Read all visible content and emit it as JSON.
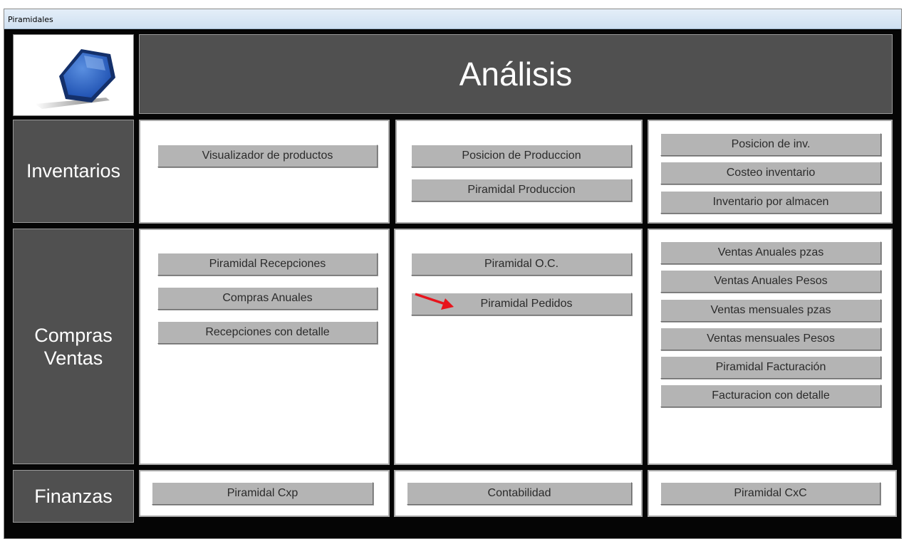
{
  "window": {
    "title": "Piramidales"
  },
  "header": {
    "title": "Análisis"
  },
  "sections": {
    "inventarios": {
      "label": "Inventarios",
      "col1": [
        "Visualizador de productos"
      ],
      "col2": [
        "Posicion de Produccion",
        "Piramidal Produccion"
      ],
      "col3": [
        "Posicion de inv.",
        "Costeo inventario",
        "Inventario por almacen"
      ]
    },
    "compras_ventas": {
      "label_line1": "Compras",
      "label_line2": "Ventas",
      "col1": [
        "Piramidal Recepciones",
        "Compras Anuales",
        "Recepciones con detalle"
      ],
      "col2": [
        "Piramidal O.C.",
        "Piramidal Pedidos"
      ],
      "col3": [
        "Ventas Anuales pzas",
        "Ventas Anuales Pesos",
        "Ventas mensuales pzas",
        "Ventas mensuales Pesos",
        "Piramidal Facturación",
        "Facturacion con detalle"
      ]
    },
    "finanzas": {
      "label": "Finanzas",
      "col1": [
        "Piramidal Cxp"
      ],
      "col2": [
        "Contabilidad"
      ],
      "col3": [
        "Piramidal CxC"
      ]
    }
  },
  "colors": {
    "dark_panel": "#505050",
    "button": "#b4b4b4",
    "arrow": "#e8141c"
  },
  "icons": {
    "logo": "hexagon-logo-icon",
    "pointer": "red-arrow-icon"
  }
}
